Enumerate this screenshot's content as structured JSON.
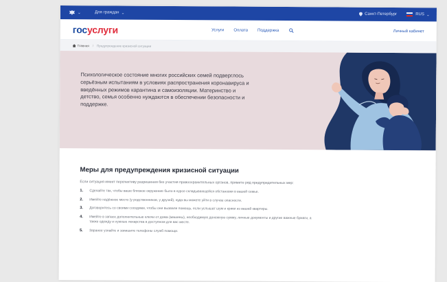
{
  "topbar": {
    "audience_label": "Для граждан",
    "location": "Санкт-Петербург",
    "language": "RUS"
  },
  "header": {
    "logo_gos": "гос",
    "logo_uslugi": "услуги",
    "nav": [
      "Услуги",
      "Оплата",
      "Поддержка"
    ],
    "cabinet": "Личный кабинет"
  },
  "breadcrumb": {
    "home": "Главная",
    "current": "Предупреждение кризисной ситуации"
  },
  "hero": {
    "text": "Психологическое состояние многих российских семей подверглось серьёзным испытаниям в условиях распространения коронавируса и введённых режимов карантина и самоизоляции. Материнство и детство, семья особенно нуждаются в обеспечении безопасности и поддержке."
  },
  "section": {
    "title": "Меры для предупреждения кризисной ситуации",
    "intro": "Если ситуация имеет перспективу разрешения без участия правоохранительных органов, примите ряд предупредительных мер:",
    "steps": [
      {
        "num": "1.",
        "text": "Сделайте так, чтобы ваше близкое окружение было в курсе складывающейся обстановки в вашей семье."
      },
      {
        "num": "2.",
        "text": "Имейте надёжное место (у родственников, у друзей), куда вы можете уйти в случае опасности."
      },
      {
        "num": "3.",
        "text": "Договоритесь со своими соседями, чтобы они вызвали помощь, если услышат шум и крики из вашей квартиры."
      },
      {
        "num": "4.",
        "text": "Имейте в запасе дополнительные ключи от дома (машины), необходимую денежную сумму, личные документы и другие важные бумаги, а также одежду и нужные лекарства в доступном для вас месте."
      },
      {
        "num": "5.",
        "text": "Заранее узнайте и запишите телефоны служб помощи."
      }
    ]
  },
  "colors": {
    "topbar": "#1e46a5",
    "brand_blue": "#1b4aa0",
    "brand_red": "#e02d3c",
    "hero_bg": "#e8dadd",
    "hero_navy": "#1f3766",
    "hero_light_blue": "#9fc3e2"
  },
  "icons": [
    "emblem-icon",
    "chevron-down-icon",
    "location-pin-icon",
    "flag-icon",
    "search-icon",
    "home-icon"
  ]
}
